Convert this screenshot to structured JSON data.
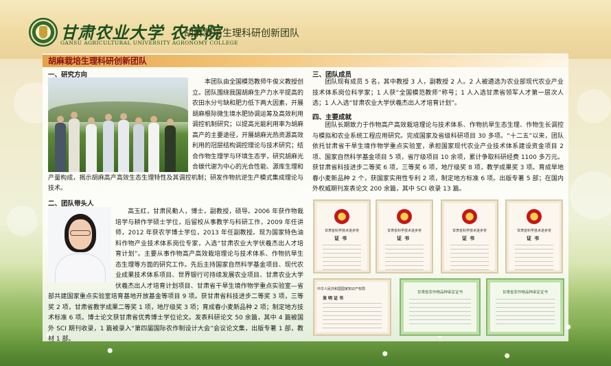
{
  "header": {
    "brand_cn": "甘肃农业大学 农学院",
    "brand_en": "GANSU AGRICULTURAL UNIVERSITY AGRONOMY COLLEGE",
    "tag": "胡麻栽培生理科研创新团队"
  },
  "main": {
    "title": "胡麻栽培生理科研创新团队",
    "sec1": {
      "heading": "一、研究方向",
      "p1": "本团队由全国模范教师牛俊义教授创立。团队围绕我国胡麻生产力水平提高的农田水分亏缺和肥力低下两大因素，开展胡麻根际微生境水肥协调运筹及高效利用调控机制研究；以提高光能利用率为胡麻高产的主要途径，开展胡麻光热资源高效利用的冠层结构调控理论与技术研究；结合作物生理学与环境生态学，研究胡麻光合碳代谢为中心的光合性能、源库生理和产量构成，揭示胡麻高产高效生态生理特性及其调控机制；研发作物抗逆生产模式集成理论与技术。"
    },
    "sec2": {
      "heading": "二、团队带头人",
      "p1": "高玉红，甘肃民勤人，博士，副教授，硕导。2006 年获作物栽培学与耕作学硕士学位，后留校从事教学与科研工作，2009 年任讲师，2012 年获农学博士学位，2013 年任副教授。现为国家特色油料作物产业技术体系岗位专家，入选“甘肃农业大学伏羲杰出人才培育计划”。主要从事作物高产高效栽培理论与技术体系、作物抗旱生态生理等方面的研究工作。先后主持国家自然科学基金项目、现代农业成果技术体系项目、世界银行可持续发展农业项目、甘肃农业大学伏羲杰出人才培育计划项目、甘肃省干旱生境作物学重点实验室—省部共建国家重点实验室培育基地开放基金等项目 9 项。获甘肃省科技进步二等奖 3 项，三等奖 2 项，甘肃省教学成果二等奖 1 项，地厅级奖 3 项；育成春小麦新品种 2 项；制定地方技术标准 6 项。博士论文获甘肃省优秀博士学位论文。发表科研论文 50 余篇，其中 4 篇被国外 SCI 期刊收录，1 篇被录入“第四届国际农作制设计大会”会议论文集，出版专著 1 部，教材 1 部。"
    },
    "sec3": {
      "heading": "三、团队成员",
      "p1": "团队现有成员 5 名，其中教授 3 人，副教授 2 人。2 人被遴选为农业部现代农业产业技术体系岗位科学家；1 人获“全国模范教师”称号；1 人入选甘肃省领军人才第一层次人选；1 人入选“甘肃农业大学伏羲杰出人才培育计划”。"
    },
    "sec4": {
      "heading": "四、主要成就",
      "p1": "团队长期致力于作物高产高效栽培理论与技术体系、作物抗旱生态生理、作物生长调控与模拟和农业系统工程应用研究。完成国家及省级科研项目 30 多项。“十二五”以来，团队依托甘肃省干旱生境作物学重点实验室，承担国家现代农业产业技术体系建设资金项目 2 项、国家自然科学基金项目 5 项，省厅级项目 10 余项，累计争取科研经费 1100 多万元。获甘肃省科技进步二等奖 6 项，三等奖 6 项，地厅级奖 8 项，教学成果奖 3 项。育成旱地春小麦新品种 2 个，获国家实用性专利 2 项，制定地方标准 6 项。出版专著 5 部；在国内外权威期刊发表论文 200 余篇，其中 SCI 收录 13 篇。"
    },
    "certs": [
      {
        "title": "甘肃省科学技术进步奖",
        "word": "证书"
      },
      {
        "title": "甘肃省科学技术进步奖",
        "word": "证书"
      },
      {
        "title": "甘肃省科学技术进步奖",
        "word": "证书"
      },
      {
        "title": "甘肃省科学技术进步奖",
        "word": "证书"
      },
      {
        "title": "中华人民共和国国家知识产权局",
        "word": "发明证书"
      },
      {
        "title": "甘肃省农作物品种审定证书",
        "word": ""
      },
      {
        "title": "甘肃省农作物品种审定证书",
        "word": ""
      }
    ]
  }
}
